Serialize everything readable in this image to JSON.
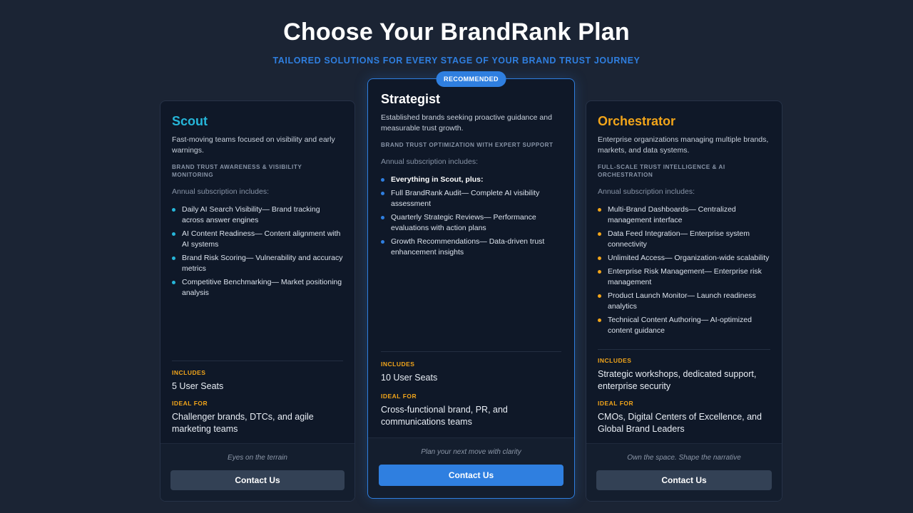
{
  "header": {
    "title": "Choose Your BrandRank Plan",
    "subtitle": "TAILORED SOLUTIONS FOR EVERY STAGE OF YOUR BRAND TRUST JOURNEY"
  },
  "colors": {
    "background": "#1b2434",
    "accent_blue": "#2f7fe0",
    "scout_cyan": "#26b6d9",
    "orchestrator_orange": "#f2a51a"
  },
  "plans": [
    {
      "name": "Scout",
      "description": "Fast-moving teams focused on visibility and early warnings.",
      "focus": "BRAND TRUST AWARENESS & VISIBILITY MONITORING",
      "annual": "Annual subscription includes:",
      "features": [
        "Daily AI Search Visibility— Brand tracking across answer engines",
        "AI Content Readiness— Content alignment with AI systems",
        "Brand Risk Scoring— Vulnerability and accuracy metrics",
        "Competitive Benchmarking— Market positioning analysis"
      ],
      "includes_label": "INCLUDES",
      "includes": "5 User Seats",
      "ideal_label": "IDEAL FOR",
      "ideal": "Challenger brands, DTCs, and agile marketing teams",
      "tagline": "Eyes on the terrain",
      "button": "Contact Us"
    },
    {
      "badge": "RECOMMENDED",
      "name": "Strategist",
      "description": "Established brands seeking proactive guidance and measurable trust growth.",
      "focus": "BRAND TRUST OPTIMIZATION WITH EXPERT SUPPORT",
      "annual": "Annual subscription includes:",
      "features": [
        "Everything in Scout, plus:",
        "Full BrandRank Audit— Complete AI visibility assessment",
        "Quarterly Strategic Reviews— Performance evaluations with action plans",
        "Growth Recommendations— Data-driven trust enhancement insights"
      ],
      "includes_label": "INCLUDES",
      "includes": "10 User Seats",
      "ideal_label": "IDEAL FOR",
      "ideal": "Cross-functional brand, PR, and communications teams",
      "tagline": "Plan your next move with clarity",
      "button": "Contact Us"
    },
    {
      "name": "Orchestrator",
      "description": "Enterprise organizations managing multiple brands, markets, and data systems.",
      "focus": "FULL-SCALE TRUST INTELLIGENCE & AI ORCHESTRATION",
      "annual": "Annual subscription includes:",
      "features": [
        "Multi-Brand Dashboards— Centralized management interface",
        "Data Feed Integration— Enterprise system connectivity",
        "Unlimited Access— Organization-wide scalability",
        "Enterprise Risk Management— Enterprise risk management",
        "Product Launch Monitor— Launch readiness analytics",
        "Technical Content Authoring— AI-optimized content guidance"
      ],
      "includes_label": "INCLUDES",
      "includes": "Strategic workshops, dedicated support, enterprise security",
      "ideal_label": "IDEAL FOR",
      "ideal": "CMOs, Digital Centers of Excellence, and Global Brand Leaders",
      "tagline": "Own the space. Shape the narrative",
      "button": "Contact Us"
    }
  ]
}
